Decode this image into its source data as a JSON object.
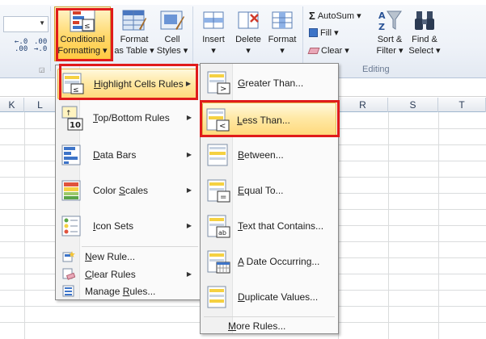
{
  "ribbon": {
    "dec_increase": ".0→.00",
    "dec_decrease": ".00→.0",
    "conditional_formatting": [
      "Conditional",
      "Formatting ▾"
    ],
    "format_as_table": [
      "Format",
      "as Table ▾"
    ],
    "cell_styles": [
      "Cell",
      "Styles ▾"
    ],
    "insert": "Insert",
    "delete": "Delete",
    "format": "Format",
    "dropdown_marker": "▾",
    "autosum": "AutoSum",
    "fill": "Fill",
    "clear": "Clear",
    "sort_filter": [
      "Sort &",
      "Filter ▾"
    ],
    "find_select": [
      "Find &",
      "Select ▾"
    ],
    "editing_group": "Editing"
  },
  "grid": {
    "columns_left": [
      "K",
      "L"
    ],
    "columns_right": [
      "R",
      "S",
      "T"
    ]
  },
  "cf_menu": {
    "items": [
      {
        "pre": "",
        "ul": "H",
        "post": "ighlight Cells Rules",
        "icon": "highlight-cells-icon",
        "submenu": true
      },
      {
        "pre": "",
        "ul": "T",
        "post": "op/Bottom Rules",
        "icon": "top-bottom-icon",
        "submenu": true
      },
      {
        "pre": "",
        "ul": "D",
        "post": "ata Bars",
        "icon": "data-bars-icon",
        "submenu": true
      },
      {
        "pre": "Color ",
        "ul": "S",
        "post": "cales",
        "icon": "color-scales-icon",
        "submenu": true
      },
      {
        "pre": "",
        "ul": "I",
        "post": "con Sets",
        "icon": "icon-sets-icon",
        "submenu": true
      }
    ],
    "small_items": [
      {
        "pre": "",
        "ul": "N",
        "post": "ew Rule...",
        "icon": "new-rule-icon"
      },
      {
        "pre": "",
        "ul": "C",
        "post": "lear Rules",
        "icon": "clear-rules-icon",
        "submenu": true
      },
      {
        "pre": "Manage ",
        "ul": "R",
        "post": "ules...",
        "icon": "manage-rules-icon"
      }
    ]
  },
  "hc_menu": {
    "items": [
      {
        "pre": "",
        "ul": "G",
        "post": "reater Than...",
        "icon": "greater-than-icon"
      },
      {
        "pre": "",
        "ul": "L",
        "post": "ess Than...",
        "icon": "less-than-icon"
      },
      {
        "pre": "",
        "ul": "B",
        "post": "etween...",
        "icon": "between-icon"
      },
      {
        "pre": "",
        "ul": "E",
        "post": "qual To...",
        "icon": "equal-to-icon"
      },
      {
        "pre": "",
        "ul": "T",
        "post": "ext that Contains...",
        "icon": "text-contains-icon"
      },
      {
        "pre": "",
        "ul": "A",
        "post": " Date Occurring...",
        "icon": "date-occurring-icon"
      },
      {
        "pre": "",
        "ul": "D",
        "post": "uplicate Values...",
        "icon": "duplicate-values-icon"
      }
    ],
    "more_rules": {
      "pre": "",
      "ul": "M",
      "post": "ore Rules..."
    }
  },
  "colors": {
    "highlight": "#ffe9a6",
    "red_annotation": "#e01b1b",
    "bar_yellow": "#f5d142"
  }
}
